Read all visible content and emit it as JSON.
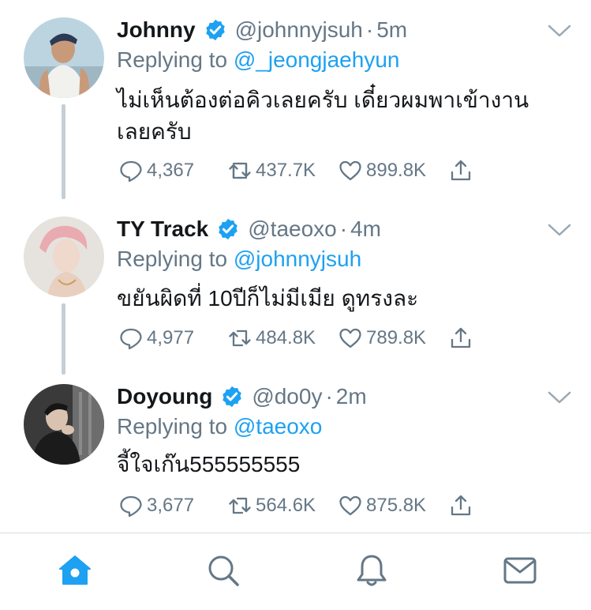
{
  "colors": {
    "accent": "#1da1f2",
    "icon_gray": "#657786",
    "text": "#14171a",
    "thread_line": "#c4cfd6"
  },
  "tweets": [
    {
      "name": "Johnny",
      "handle": "@johnnyjsuh",
      "dot": "·",
      "time": "5m",
      "replying_prefix": "Replying to ",
      "replying_to": "@_jeongjaehyun",
      "text": "ไม่เห็นต้องต่อคิวเลยครับ เดี๋ยวผมพาเข้างานเลยครับ",
      "replies": "4,367",
      "retweets": "437.7K",
      "likes": "899.8K",
      "avatar_icon": "avatar-photo"
    },
    {
      "name": "TY Track",
      "handle": "@taeoxo",
      "dot": "·",
      "time": "4m",
      "replying_prefix": "Replying to ",
      "replying_to": "@johnnyjsuh",
      "text": "ขยันผิดที่ 10ปีก็ไม่มีเมีย ดูทรงละ",
      "replies": "4,977",
      "retweets": "484.8K",
      "likes": "789.8K",
      "avatar_icon": "avatar-photo"
    },
    {
      "name": "Doyoung",
      "handle": "@do0y",
      "dot": "·",
      "time": "2m",
      "replying_prefix": "Replying to ",
      "replying_to": "@taeoxo",
      "text": "จี้ใจเก๊น555555555",
      "replies": "3,677",
      "retweets": "564.6K",
      "likes": "875.8K",
      "avatar_icon": "avatar-photo"
    }
  ],
  "tabbar": {
    "items": [
      "home-icon",
      "search-icon",
      "notifications-icon",
      "messages-icon"
    ],
    "active": "home-icon"
  }
}
